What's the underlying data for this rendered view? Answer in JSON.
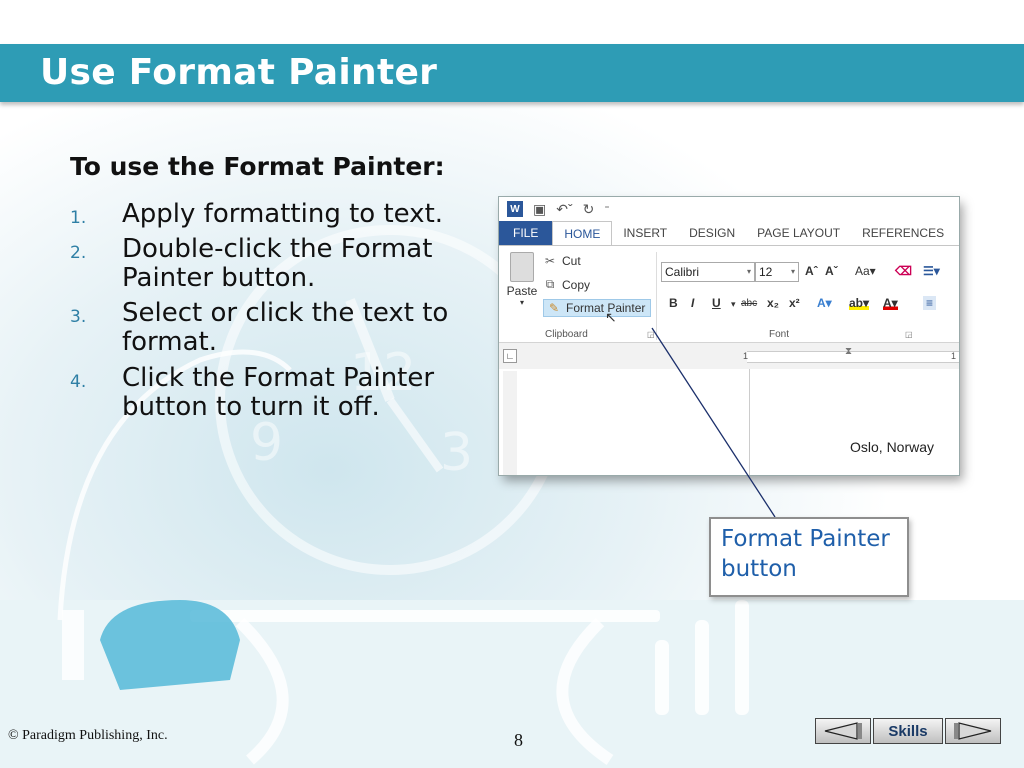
{
  "slide": {
    "title": "Use Format Painter",
    "intro": "To use the Format Painter:",
    "steps": [
      {
        "num": "1.",
        "text": "Apply formatting to text."
      },
      {
        "num": "2.",
        "text": "Double-click the Format Painter button."
      },
      {
        "num": "3.",
        "text": "Select or click the text to format."
      },
      {
        "num": "4.",
        "text": "Click the Format Painter button to turn it off."
      }
    ],
    "callout": "Format Painter button",
    "copyright": "© Paradigm Publishing, Inc.",
    "page_number": "8",
    "nav": {
      "skills_label": "Skills"
    }
  },
  "word": {
    "tabs": [
      "FILE",
      "HOME",
      "INSERT",
      "DESIGN",
      "PAGE LAYOUT",
      "REFERENCES"
    ],
    "clipboard": {
      "paste": "Paste",
      "cut": "Cut",
      "copy": "Copy",
      "format_painter": "Format Painter",
      "group_label": "Clipboard"
    },
    "font": {
      "name": "Calibri",
      "size": "12",
      "group_label": "Font"
    },
    "ruler_left": "1",
    "ruler_right": "1",
    "document_text": "Oslo, Norway"
  },
  "colors": {
    "title_bar": "#2e9cb5",
    "word_accent": "#2b579a",
    "callout_text": "#1f5faa"
  }
}
